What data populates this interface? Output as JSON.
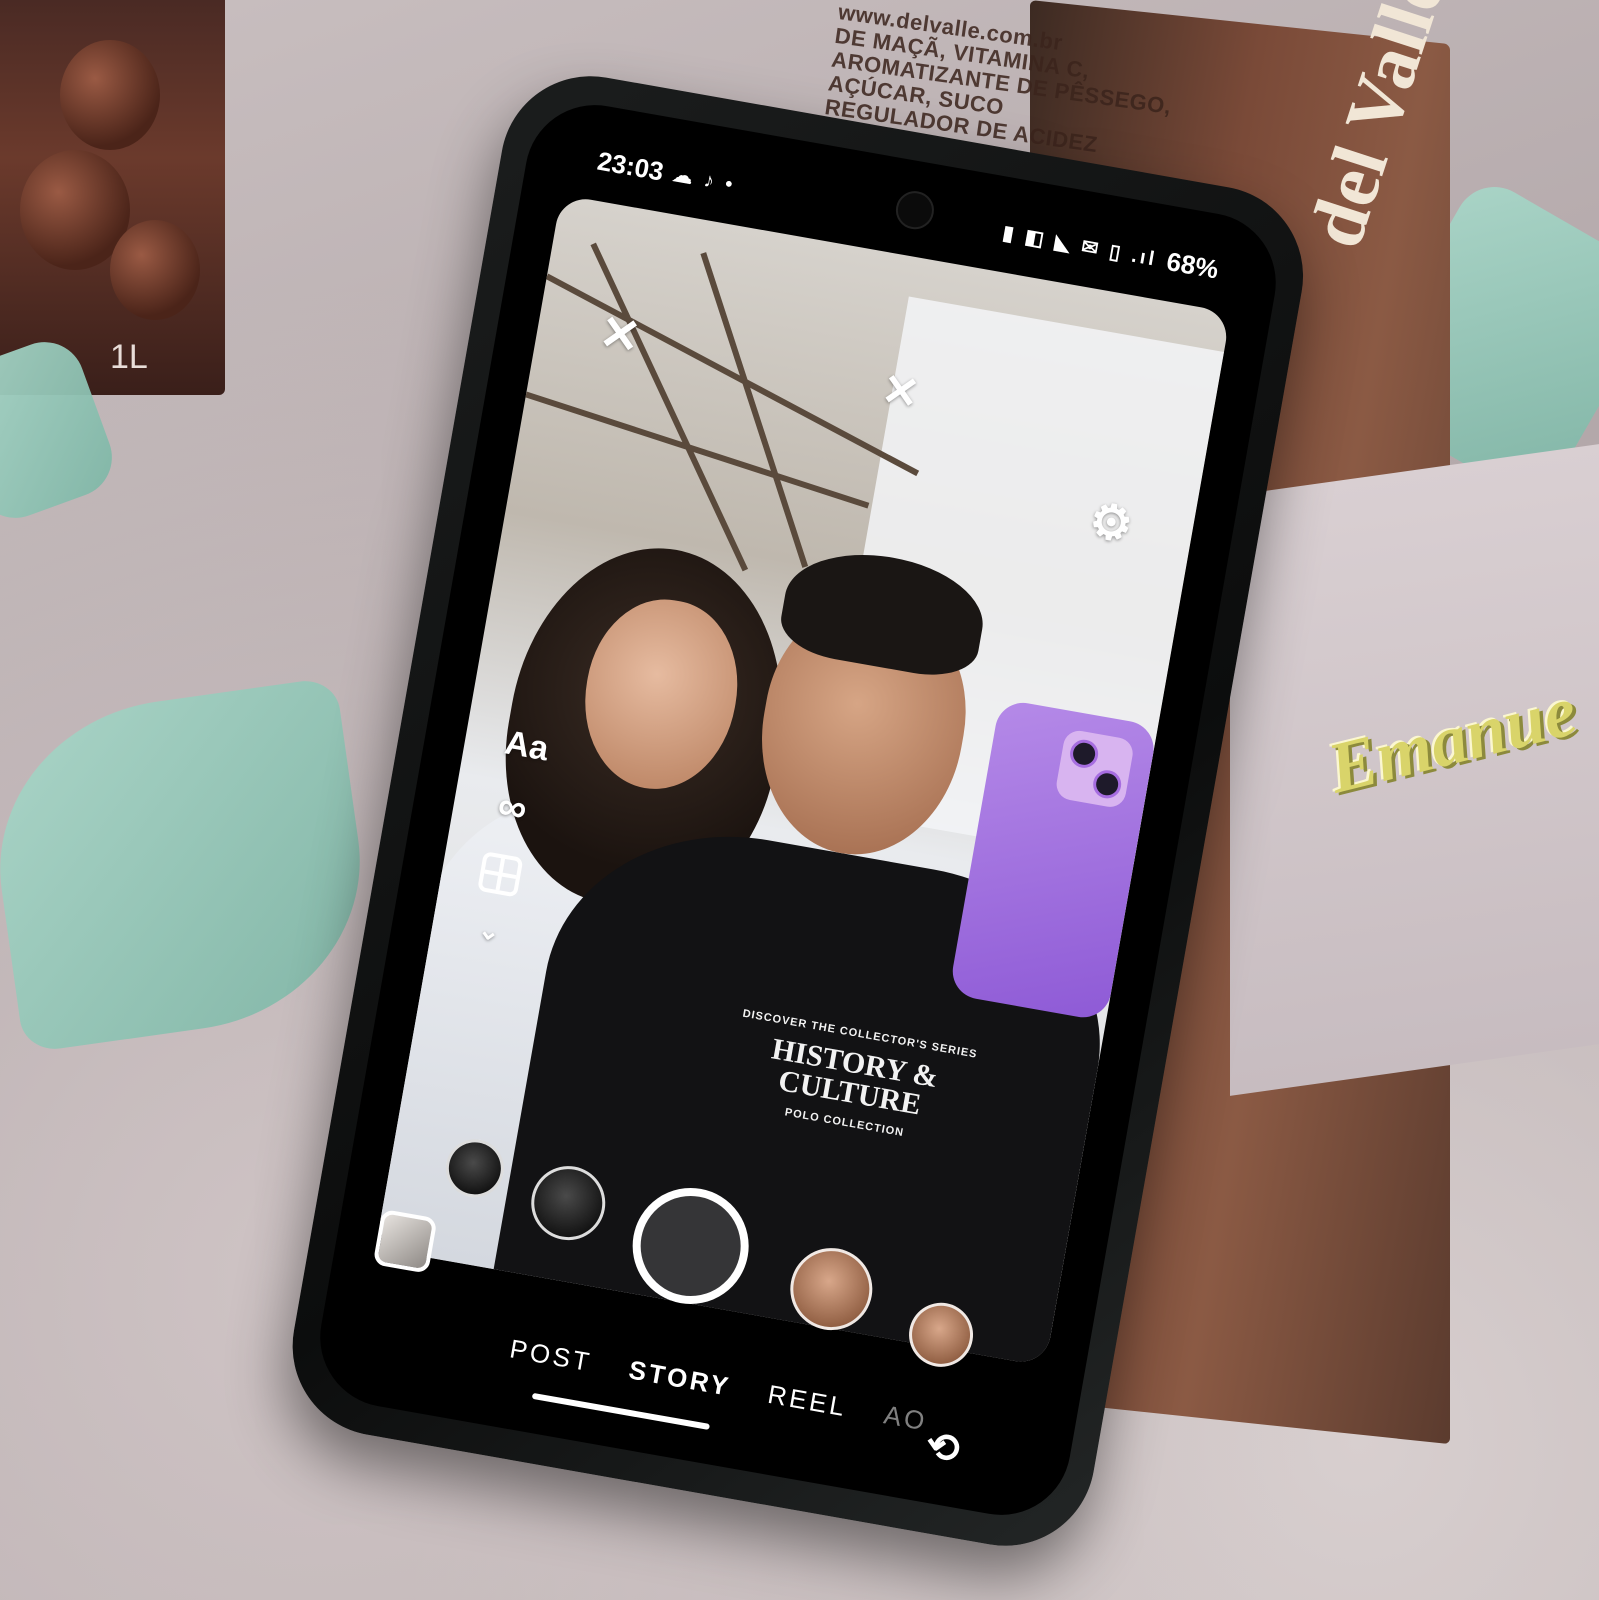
{
  "background": {
    "left_carton_volume": "1L",
    "right_carton_fineprint": [
      "DE MAÇÃ, VITAMINA C, AROMATIZANTE DE PÊSSEGO, AÇÚCAR, SUCO",
      "www.delvalle.com.br",
      "REGULADOR DE ACIDEZ"
    ],
    "right_carton_brand": "del Valle",
    "name_tag": "Emanue"
  },
  "status_bar": {
    "time": "23:03",
    "battery": "68%",
    "left_icons": "☁ ♪ •",
    "right_icons": "▮ ◧ ◣ ✉ ▯ .ıl"
  },
  "camera": {
    "text_tool_label": "Aa",
    "shirt_print": {
      "line1": "DISCOVER THE COLLECTOR'S SERIES",
      "line2": "HISTORY & CULTURE",
      "line3": "POLO COLLECTION"
    },
    "modes": [
      "POST",
      "STORY",
      "REEL",
      "AO"
    ],
    "active_mode": "STORY"
  },
  "icons": {
    "close": "✕",
    "flash_off": "✕",
    "settings": "⚙",
    "boomerang": "∞",
    "chevron_down": "⌄",
    "flip_camera": "⟲"
  },
  "colors": {
    "held_phone": "#9b6ae0",
    "ribbon": "#a9d6c8",
    "name_tag": "#d9d46a"
  }
}
